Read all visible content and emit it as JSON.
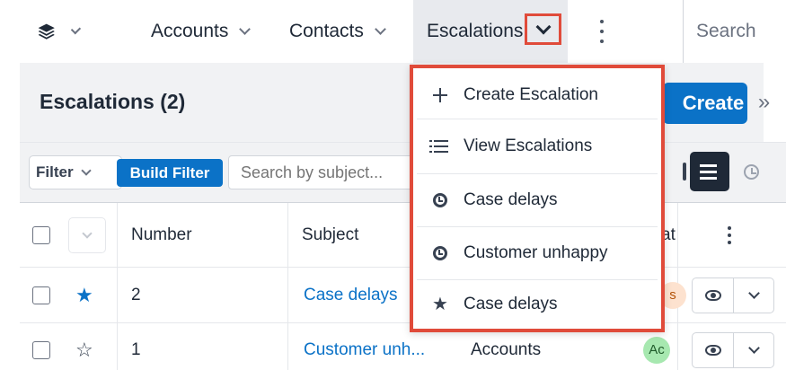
{
  "topnav": {
    "logo_icon": "stack-logo-icon",
    "items": [
      {
        "label": "Accounts"
      },
      {
        "label": "Contacts"
      },
      {
        "label": "Escalations"
      }
    ],
    "search_label": "Search"
  },
  "list": {
    "title": "Escalations (2)",
    "create_label": "Create",
    "side_toggle": "»"
  },
  "filter": {
    "filter_label": "Filter",
    "build_filter_label": "Build Filter",
    "search_placeholder": "Search by subject..."
  },
  "table": {
    "columns": [
      "Number",
      "Subject",
      "at"
    ],
    "rows": [
      {
        "favorite": true,
        "number": "2",
        "subject": "Case delays",
        "status_badge": "s"
      },
      {
        "favorite": false,
        "number": "1",
        "subject": "Customer unh...",
        "related": "Accounts",
        "status_badge": "Ac"
      }
    ]
  },
  "dropdown": {
    "items": [
      {
        "label": "Create Escalation",
        "icon": "plus-icon"
      },
      {
        "label": "View Escalations",
        "icon": "list-icon"
      },
      {
        "label": "Case delays",
        "icon": "clock-icon"
      },
      {
        "label": "Customer unhappy",
        "icon": "clock-icon"
      },
      {
        "label": "Case delays",
        "icon": "star-icon"
      }
    ]
  },
  "colors": {
    "accent": "#0b72c7",
    "highlight": "#e04b3a",
    "header_bg": "#f1f2f4",
    "badge_green": "#a7e8b0",
    "badge_peach": "#fde2cf"
  }
}
